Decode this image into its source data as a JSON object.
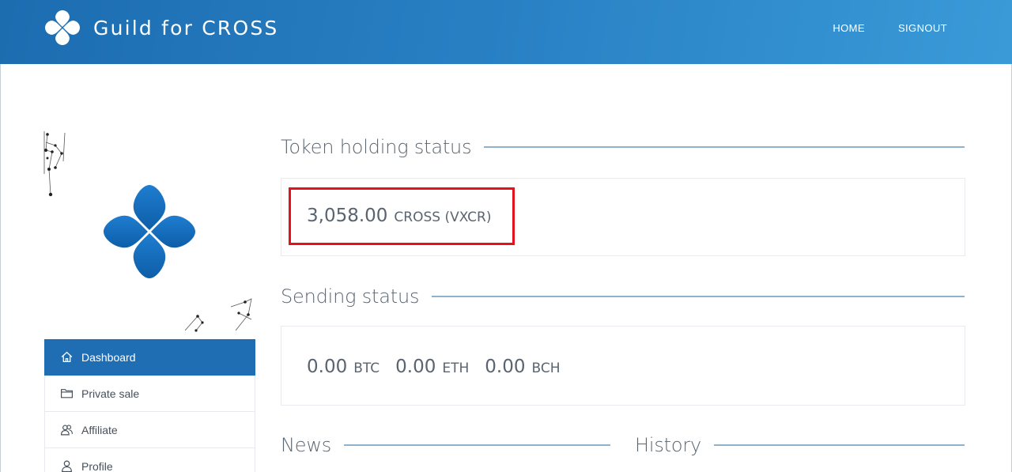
{
  "header": {
    "brand_text": "Guild for CROSS",
    "nav": {
      "home": "HOME",
      "signout": "SIGNOUT"
    }
  },
  "sidebar": {
    "items": [
      {
        "label": "Dashboard",
        "icon": "home-icon",
        "active": true
      },
      {
        "label": "Private sale",
        "icon": "folder-icon",
        "active": false
      },
      {
        "label": "Affiliate",
        "icon": "users-icon",
        "active": false
      },
      {
        "label": "Profile",
        "icon": "user-icon",
        "active": false
      }
    ]
  },
  "token_holding": {
    "title": "Token holding status",
    "amount": "3,058.00",
    "unit": "CROSS (VXCR)"
  },
  "sending": {
    "title": "Sending status",
    "items": [
      {
        "amount": "0.00",
        "unit": "BTC"
      },
      {
        "amount": "0.00",
        "unit": "ETH"
      },
      {
        "amount": "0.00",
        "unit": "BCH"
      }
    ]
  },
  "news": {
    "title": "News"
  },
  "history": {
    "title": "History"
  },
  "colors": {
    "brand_blue": "#1f6eb4",
    "highlight": "#e5121b",
    "rule": "#8fb1c9"
  }
}
